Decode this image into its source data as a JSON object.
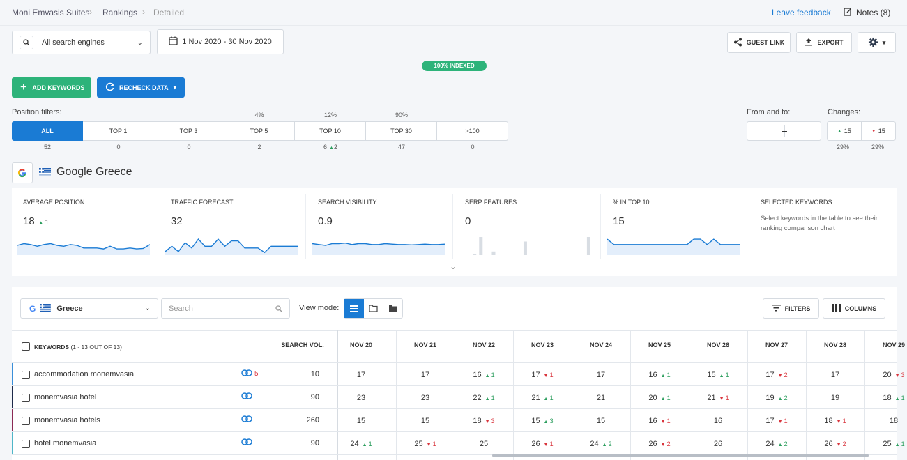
{
  "breadcrumb": {
    "project": "Moni Emvasis Suites",
    "section": "Rankings",
    "current": "Detailed"
  },
  "header": {
    "feedback": "Leave feedback",
    "notes": "Notes (8)"
  },
  "toolbar": {
    "engine_select": "All search engines",
    "date_range": "1 Nov 2020 - 30 Nov 2020",
    "guest_link": "GUEST LINK",
    "export": "EXPORT",
    "indexed_badge": "100% INDEXED",
    "add_keywords": "ADD KEYWORDS",
    "recheck": "RECHECK DATA"
  },
  "filters": {
    "title": "Position filters:",
    "tabs": [
      {
        "label": "ALL",
        "pct": "",
        "count": "52",
        "delta": ""
      },
      {
        "label": "TOP 1",
        "pct": "",
        "count": "0",
        "delta": ""
      },
      {
        "label": "TOP 3",
        "pct": "",
        "count": "0",
        "delta": ""
      },
      {
        "label": "TOP 5",
        "pct": "4%",
        "count": "2",
        "delta": ""
      },
      {
        "label": "TOP 10",
        "pct": "12%",
        "count": "6",
        "delta": "2"
      },
      {
        "label": "TOP 30",
        "pct": "90%",
        "count": "47",
        "delta": ""
      },
      {
        "label": ">100",
        "pct": "",
        "count": "0",
        "delta": ""
      }
    ],
    "from_to_label": "From and to:",
    "changes_label": "Changes:",
    "changes_up": "15",
    "changes_down": "15",
    "changes_up_pct": "29%",
    "changes_down_pct": "29%"
  },
  "engine": {
    "name": "Google Greece"
  },
  "metrics": [
    {
      "label": "AVERAGE POSITION",
      "value": "18",
      "delta": "1",
      "trend": [
        0.55,
        0.45,
        0.5,
        0.6,
        0.5,
        0.45,
        0.55,
        0.6,
        0.5,
        0.55,
        0.7,
        0.7,
        0.7,
        0.75,
        0.6,
        0.75,
        0.75,
        0.7,
        0.75,
        0.72,
        0.5
      ]
    },
    {
      "label": "TRAFFIC FORECAST",
      "value": "32",
      "delta": "",
      "trend": [
        0.9,
        0.6,
        0.9,
        0.4,
        0.7,
        0.2,
        0.6,
        0.6,
        0.2,
        0.6,
        0.3,
        0.3,
        0.7,
        0.7,
        0.7,
        0.95,
        0.6,
        0.6,
        0.6,
        0.6,
        0.6
      ]
    },
    {
      "label": "SEARCH VISIBILITY",
      "value": "0.9",
      "delta": "",
      "trend": [
        0.45,
        0.5,
        0.55,
        0.45,
        0.45,
        0.42,
        0.5,
        0.45,
        0.45,
        0.5,
        0.5,
        0.45,
        0.48,
        0.5,
        0.5,
        0.52,
        0.5,
        0.48,
        0.5,
        0.5,
        0.48
      ]
    },
    {
      "label": "SERP FEATURES",
      "value": "0",
      "delta": "",
      "bars": [
        0,
        0,
        0.05,
        1,
        0,
        0.2,
        0,
        0,
        0,
        0,
        0.75,
        0,
        0,
        0,
        0,
        0,
        0,
        0,
        0,
        0,
        1
      ]
    },
    {
      "label": "% IN TOP 10",
      "value": "15",
      "delta": "",
      "trend": [
        0.2,
        0.5,
        0.5,
        0.5,
        0.5,
        0.5,
        0.5,
        0.5,
        0.5,
        0.5,
        0.5,
        0.5,
        0.5,
        0.2,
        0.2,
        0.5,
        0.2,
        0.5,
        0.5,
        0.5,
        0.5
      ]
    }
  ],
  "selected_keywords": {
    "title": "SELECTED KEYWORDS",
    "text": "Select keywords in the table to see their ranking comparison chart"
  },
  "table_toolbar": {
    "region": "Greece",
    "search_placeholder": "Search",
    "view_mode": "View mode:",
    "filters": "FILTERS",
    "columns": "COLUMNS"
  },
  "table": {
    "kw_header": "KEYWORDS",
    "kw_count": "(1 - 13 OUT OF 13)",
    "vol_header": "SEARCH VOL.",
    "dates": [
      "NOV 20",
      "NOV 21",
      "NOV 22",
      "NOV 23",
      "NOV 24",
      "NOV 25",
      "NOV 26",
      "NOV 27",
      "NOV 28",
      "NOV 29"
    ],
    "rows": [
      {
        "keyword": "accommodation monemvasia",
        "links": "5",
        "vol": "10",
        "color": "#3b8fd9",
        "cells": [
          [
            "17",
            "",
            ""
          ],
          [
            "17",
            "",
            ""
          ],
          [
            "16",
            "up",
            "1"
          ],
          [
            "17",
            "dn",
            "1"
          ],
          [
            "17",
            "",
            ""
          ],
          [
            "16",
            "up",
            "1"
          ],
          [
            "15",
            "up",
            "1"
          ],
          [
            "17",
            "dn",
            "2"
          ],
          [
            "17",
            "",
            ""
          ],
          [
            "20",
            "dn",
            "3"
          ]
        ]
      },
      {
        "keyword": "monemvasia hotel",
        "links": "",
        "vol": "90",
        "color": "#1e2a4a",
        "cells": [
          [
            "23",
            "",
            ""
          ],
          [
            "23",
            "",
            ""
          ],
          [
            "22",
            "up",
            "1"
          ],
          [
            "21",
            "up",
            "1"
          ],
          [
            "21",
            "",
            ""
          ],
          [
            "20",
            "up",
            "1"
          ],
          [
            "21",
            "dn",
            "1"
          ],
          [
            "19",
            "up",
            "2"
          ],
          [
            "19",
            "",
            ""
          ],
          [
            "18",
            "up",
            "1"
          ]
        ]
      },
      {
        "keyword": "monemvasia hotels",
        "links": "",
        "vol": "260",
        "color": "#8b2a55",
        "cells": [
          [
            "15",
            "",
            ""
          ],
          [
            "15",
            "",
            ""
          ],
          [
            "18",
            "dn",
            "3"
          ],
          [
            "15",
            "up",
            "3"
          ],
          [
            "15",
            "",
            ""
          ],
          [
            "16",
            "dn",
            "1"
          ],
          [
            "16",
            "",
            ""
          ],
          [
            "17",
            "dn",
            "1"
          ],
          [
            "18",
            "dn",
            "1"
          ],
          [
            "18",
            "",
            ""
          ]
        ]
      },
      {
        "keyword": "hotel monemvasia",
        "links": "",
        "vol": "90",
        "color": "#4fb6c8",
        "cells": [
          [
            "24",
            "up",
            "1"
          ],
          [
            "25",
            "dn",
            "1"
          ],
          [
            "25",
            "",
            ""
          ],
          [
            "26",
            "dn",
            "1"
          ],
          [
            "24",
            "up",
            "2"
          ],
          [
            "26",
            "dn",
            "2"
          ],
          [
            "26",
            "",
            ""
          ],
          [
            "24",
            "up",
            "2"
          ],
          [
            "26",
            "dn",
            "2"
          ],
          [
            "25",
            "up",
            "1"
          ]
        ]
      }
    ]
  }
}
